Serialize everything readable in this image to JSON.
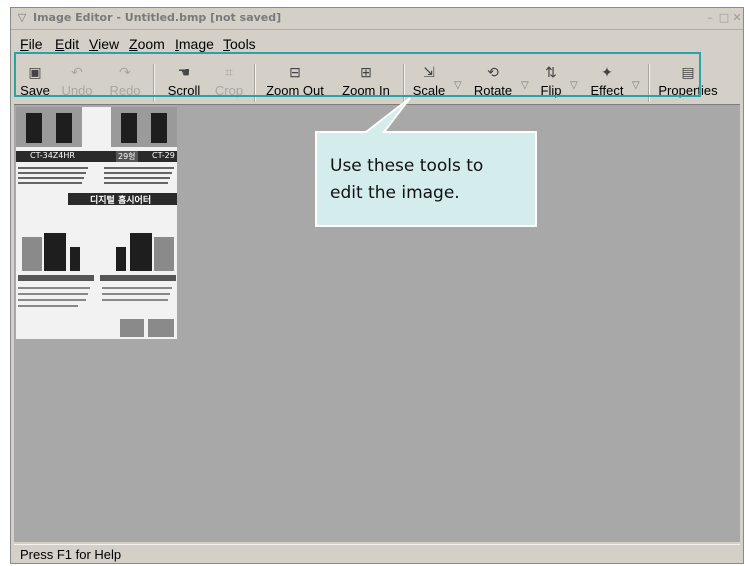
{
  "window": {
    "title": "Image Editor - Untitled.bmp [not saved]",
    "minimize_glyph": "–",
    "maximize_glyph": "□",
    "close_glyph": "✕"
  },
  "menubar": {
    "items": [
      {
        "mnemonic": "F",
        "rest": "ile"
      },
      {
        "mnemonic": "E",
        "rest": "dit"
      },
      {
        "mnemonic": "V",
        "rest": "iew"
      },
      {
        "mnemonic": "Z",
        "rest": "oom"
      },
      {
        "mnemonic": "I",
        "rest": "mage"
      },
      {
        "mnemonic": "T",
        "rest": "ools"
      }
    ]
  },
  "toolbar": {
    "save": "Save",
    "undo": "Undo",
    "redo": "Redo",
    "scroll": "Scroll",
    "crop": "Crop",
    "zoom_out": "Zoom Out",
    "zoom_in": "Zoom In",
    "scale": "Scale",
    "rotate": "Rotate",
    "flip": "Flip",
    "effect": "Effect",
    "properties": "Properties"
  },
  "callout": {
    "line1": "Use these tools to",
    "line2": "edit the image."
  },
  "thumbnail": {
    "model_left": "CT-34Z4HR",
    "badge": "29형",
    "model_right": "CT-29",
    "banner": "디지털 홈시어터"
  },
  "statusbar": {
    "text": "Press F1 for Help"
  },
  "colors": {
    "callout_fill": "#d4ecec",
    "callout_border": "#ffffff",
    "toolbar_highlight": "#2aa2a6",
    "canvas": "#a8a8a8"
  }
}
